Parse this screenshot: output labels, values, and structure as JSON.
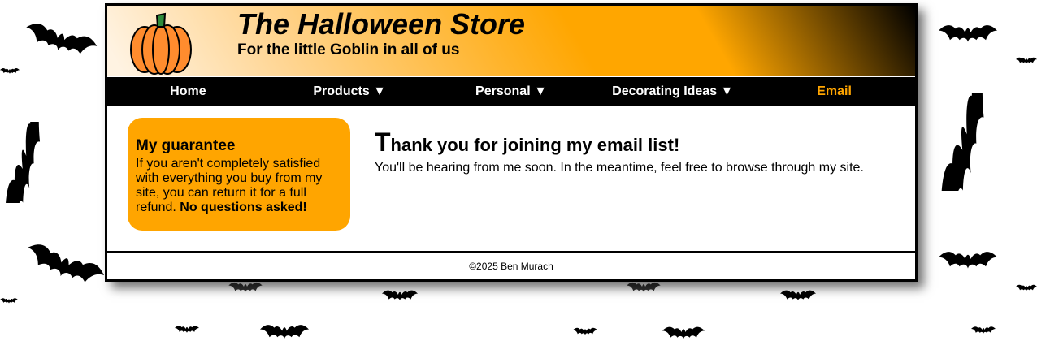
{
  "store": {
    "title": "The Halloween Store",
    "tagline": "For the little Goblin in all of us"
  },
  "nav": {
    "home": "Home",
    "products": "Products ▼",
    "personal": "Personal ▼",
    "decorating": "Decorating Ideas ▼",
    "email": "Email"
  },
  "sidebar": {
    "heading": "My guarantee",
    "text": "If you aren't completely satisfied with everything you buy from my site, you can return it for a full refund.",
    "emphasis": "No questions asked!"
  },
  "main": {
    "heading_initial": "T",
    "heading_rest": "hank you for joining my email list!",
    "message": "You'll be hearing from me soon. In the meantime, feel free to browse through my site."
  },
  "footer": {
    "copyright": "©2025 Ben Murach"
  },
  "colors": {
    "accent": "#ffa500",
    "nav_background": "#000000",
    "current_nav_text": "#ffa500"
  },
  "icons": {
    "logo": "pumpkin-icon",
    "background": "bat-icon"
  }
}
